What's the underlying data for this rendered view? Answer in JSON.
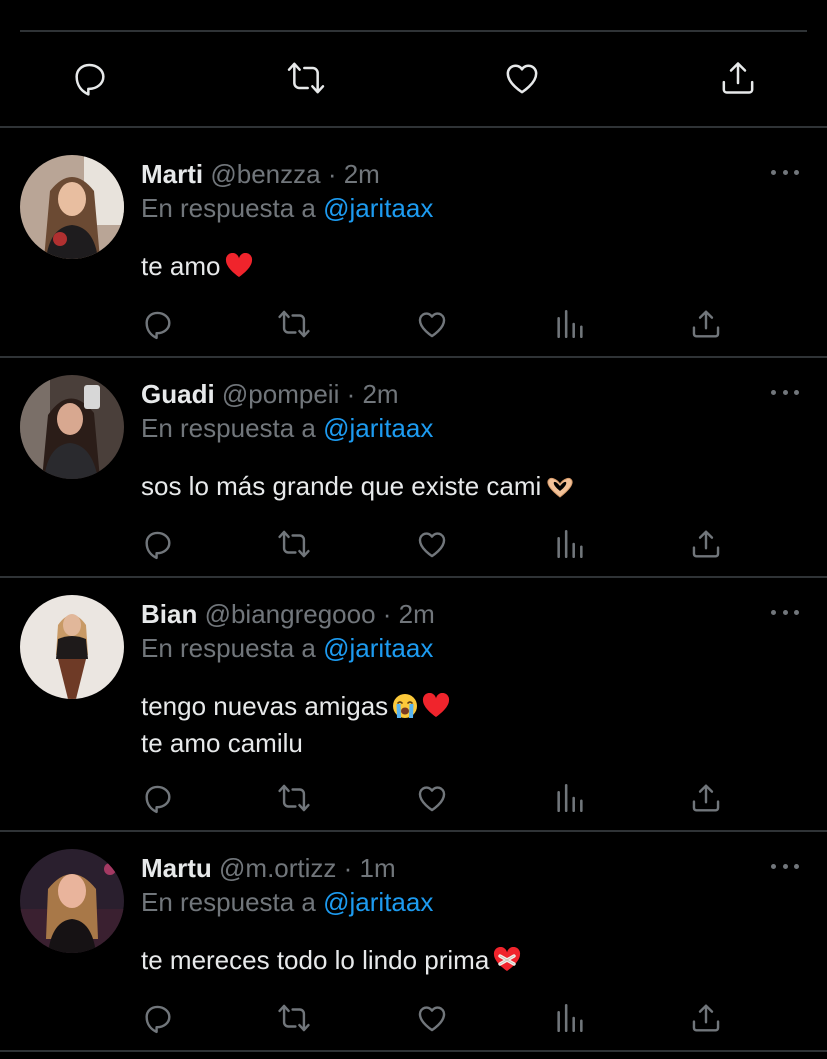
{
  "colors": {
    "background": "#000000",
    "text": "#e7e9ea",
    "muted": "#71767b",
    "accent": "#1d9bf0",
    "divider": "#2f3336",
    "heart": "#f91880"
  },
  "top_actions": {
    "icons": [
      "reply-icon",
      "retweet-icon",
      "like-icon",
      "share-icon"
    ]
  },
  "replies": [
    {
      "name": "Marti",
      "handle": "@benzza",
      "time": "· 2m",
      "reply_to_prefix": "En respuesta a",
      "reply_to": "@jaritaax",
      "lines": [
        "te amo"
      ],
      "emojis": [
        "red-heart"
      ]
    },
    {
      "name": "Guadi",
      "handle": "@pompeii",
      "time": "· 2m",
      "reply_to_prefix": "En respuesta a",
      "reply_to": "@jaritaax",
      "lines": [
        "sos lo más grande que existe cami"
      ],
      "emojis": [
        "heart-hands"
      ]
    },
    {
      "name": "Bian",
      "handle": "@biangregooo",
      "time": "· 2m",
      "reply_to_prefix": "En respuesta a",
      "reply_to": "@jaritaax",
      "lines": [
        "tengo nuevas amigas",
        "te amo camilu"
      ],
      "emojis": [
        "crying-face",
        "red-heart"
      ]
    },
    {
      "name": "Martu",
      "handle": "@m.ortizz",
      "time": "· 1m",
      "reply_to_prefix": "En respuesta a",
      "reply_to": "@jaritaax",
      "lines": [
        "te mereces todo lo lindo prima"
      ],
      "emojis": [
        "mending-heart"
      ]
    }
  ]
}
